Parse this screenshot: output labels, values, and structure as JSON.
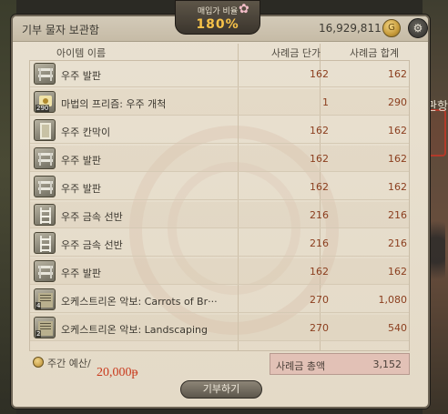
{
  "window": {
    "title": "기부 물자 보관함",
    "gil": "16,929,811",
    "close_icon": "⚙"
  },
  "rate": {
    "label": "매입가 비율",
    "value": "180%"
  },
  "columns": {
    "name": "아이템 이름",
    "price": "사례금 단가",
    "total": "사례금 합계"
  },
  "items": [
    {
      "name": "우주 발판",
      "price": "162",
      "total": "162",
      "icon": "scaffold-icon",
      "badge": ""
    },
    {
      "name": "마법의 프리즘: 우주 개척",
      "price": "1",
      "total": "290",
      "icon": "prism-icon",
      "badge": "290"
    },
    {
      "name": "우주 칸막이",
      "price": "162",
      "total": "162",
      "icon": "partition-icon",
      "badge": ""
    },
    {
      "name": "우주 발판",
      "price": "162",
      "total": "162",
      "icon": "scaffold-icon",
      "badge": ""
    },
    {
      "name": "우주 발판",
      "price": "162",
      "total": "162",
      "icon": "scaffold-icon",
      "badge": ""
    },
    {
      "name": "우주 금속 선반",
      "price": "216",
      "total": "216",
      "icon": "shelf-icon",
      "badge": ""
    },
    {
      "name": "우주 금속 선반",
      "price": "216",
      "total": "216",
      "icon": "shelf-icon",
      "badge": ""
    },
    {
      "name": "우주 발판",
      "price": "162",
      "total": "162",
      "icon": "scaffold-icon",
      "badge": ""
    },
    {
      "name": "오케스트리온 악보: Carrots of Br···",
      "price": "270",
      "total": "1,080",
      "icon": "sheet-music-icon",
      "badge": "4"
    },
    {
      "name": "오케스트리온 악보: Landscaping",
      "price": "270",
      "total": "540",
      "icon": "sheet-music-icon",
      "badge": "2"
    }
  ],
  "budget": {
    "label": "주간 예산/",
    "value": "20,000ᵽ"
  },
  "summary": {
    "label": "사례금 총액",
    "value": "3,152"
  },
  "donate_button": "기부하기",
  "background": {
    "right_text": "관항"
  },
  "colors": {
    "accent": "#f7c248",
    "price_text": "#8b3e1e",
    "budget_text": "#c8391c",
    "total_box": "#e2c1b6"
  }
}
